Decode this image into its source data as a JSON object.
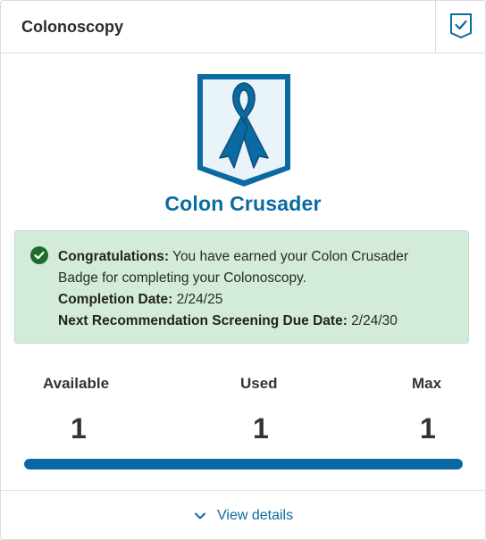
{
  "header": {
    "title": "Colonoscopy",
    "status_icon": "checkbox-check-icon"
  },
  "badge": {
    "name": "Colon Crusader",
    "icon": "awareness-ribbon-icon",
    "color": "#0a6aa1"
  },
  "alert": {
    "icon": "check-circle-icon",
    "congrats_label": "Congratulations:",
    "congrats_text": " You have earned your Colon Crusader Badge for completing your Colonoscopy.",
    "completion_label": "Completion Date:",
    "completion_value": " 2/24/25",
    "next_label": "Next Recommendation Screening Due Date:",
    "next_value": " 2/24/30"
  },
  "stats": {
    "available_label": "Available",
    "available_value": "1",
    "used_label": "Used",
    "used_value": "1",
    "max_label": "Max",
    "max_value": "1",
    "progress_fraction": 1.0
  },
  "footer": {
    "view_details_label": "View details",
    "icon": "chevron-down-icon"
  },
  "colors": {
    "accent": "#0a6aa1",
    "success_bg": "#d3ecd9",
    "success_icon": "#1e6b2c"
  }
}
